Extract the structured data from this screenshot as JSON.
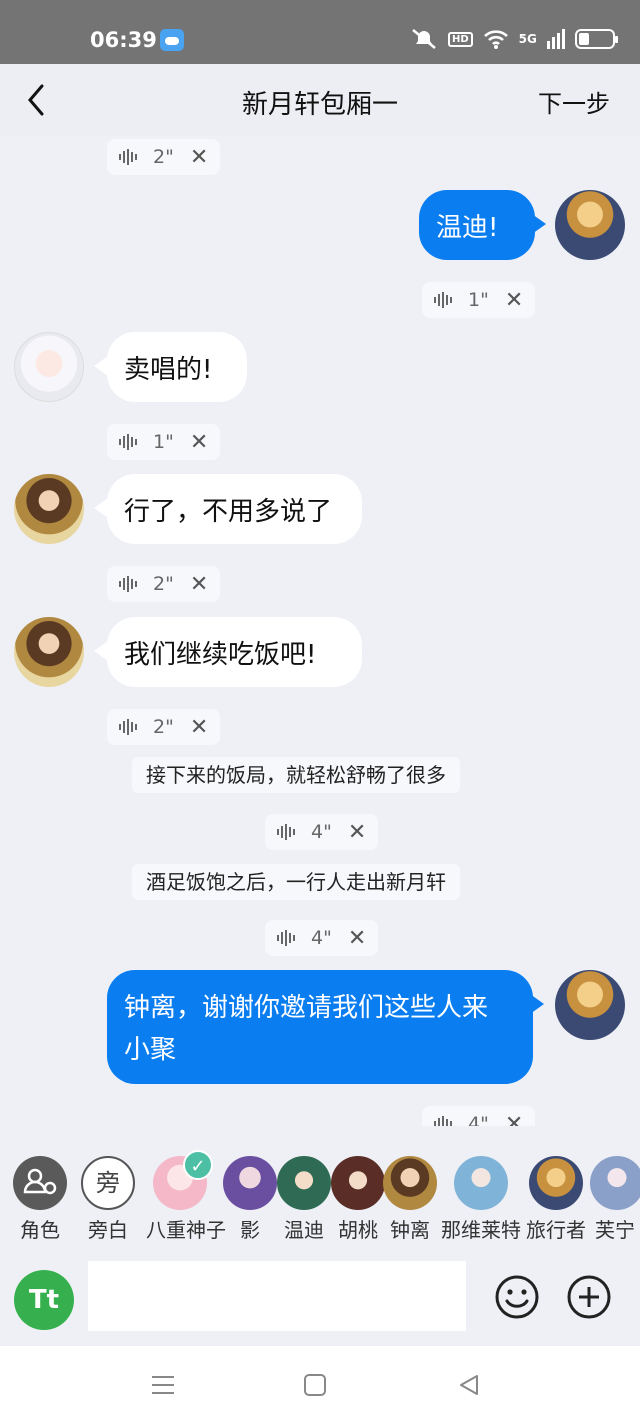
{
  "status": {
    "time": "06:39",
    "hd": "HD",
    "signal": "5G"
  },
  "header": {
    "title": "新月轩包厢一",
    "next_label": "下一步"
  },
  "messages": {
    "v0": {
      "duration": "2\""
    },
    "m1": {
      "text": "温迪!",
      "voice": "1\""
    },
    "m2": {
      "text": "卖唱的!",
      "voice": "1\""
    },
    "m3": {
      "text": "行了，不用多说了",
      "voice": "2\""
    },
    "m4": {
      "text": "我们继续吃饭吧!",
      "voice": "2\""
    },
    "n1": {
      "text": "接下来的饭局，就轻松舒畅了很多",
      "voice": "4\""
    },
    "n2": {
      "text": "酒足饭饱之后，一行人走出新月轩",
      "voice": "4\""
    },
    "m5": {
      "line1": "钟离，谢谢你邀请我们这些人来",
      "line2": "小聚",
      "voice": "4\""
    },
    "close_glyph": "✕"
  },
  "characters": [
    {
      "name": "角色",
      "color": "#5a5a5a"
    },
    {
      "name": "旁白",
      "glyph": "旁"
    },
    {
      "name": "八重神子",
      "color": "#f4b8c8"
    },
    {
      "name": "影",
      "color": "#6a4fa0"
    },
    {
      "name": "温迪",
      "color": "#2f6b54"
    },
    {
      "name": "胡桃",
      "color": "#5a2e26"
    },
    {
      "name": "钟离",
      "color": "#8a6a3a"
    },
    {
      "name": "那维莱特",
      "color": "#7fb4d8"
    },
    {
      "name": "旅行者",
      "color": "#c8913f"
    },
    {
      "name": "芙宁",
      "color": "#8aa0c8"
    }
  ],
  "input": {
    "tt": "Tt",
    "placeholder": ""
  },
  "colors": {
    "accent_blue": "#0a7df1",
    "green": "#36b04e",
    "check": "#4cbfa5"
  }
}
